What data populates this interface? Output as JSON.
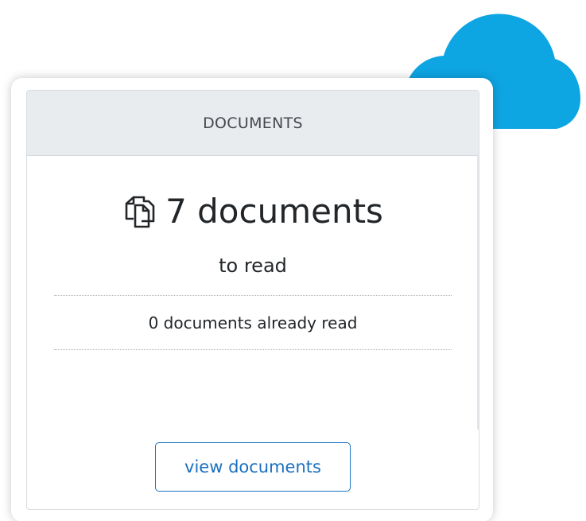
{
  "card": {
    "header_title": "DOCUMENTS",
    "headline": "7 documents",
    "subline": "to read",
    "already_read": "0 documents already read",
    "button_label": "view documents"
  },
  "icons": {
    "header_icon": "documents-icon",
    "decoration": "cloud-icon"
  },
  "colors": {
    "cloud": "#0ea5e3",
    "header_bg": "#e9ecef",
    "button_border": "#1a73c4",
    "button_text": "#1a6fbf",
    "text": "#222629"
  }
}
